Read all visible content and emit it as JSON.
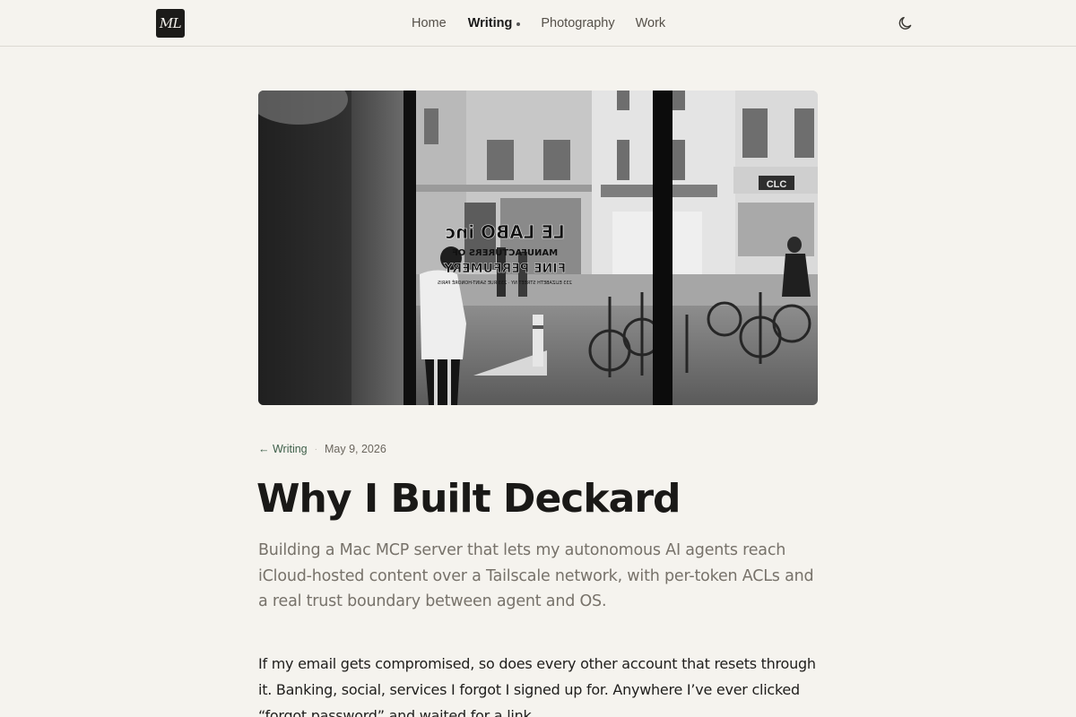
{
  "header": {
    "logo_text": "ML",
    "nav": [
      {
        "label": "Home",
        "active": false
      },
      {
        "label": "Writing",
        "active": true
      },
      {
        "label": "Photography",
        "active": false
      },
      {
        "label": "Work",
        "active": false
      }
    ],
    "theme_toggle_icon": "moon-icon"
  },
  "hero": {
    "storefront_text": [
      "LE LABO inc",
      "MANUFACTURERS OF",
      "FINE PERFUMERY"
    ],
    "storefront_small": "233 ELIZABETH STREET NY · 233 RUE SAINT-HONORÉ PARIS",
    "shop_sign": "CLC"
  },
  "article": {
    "back_label": "← Writing",
    "date": "May 9, 2026",
    "title": "Why I Built Deckard",
    "subtitle": "Building a Mac MCP server that lets my autonomous AI agents reach iCloud-hosted content over a Tailscale network, with per-token ACLs and a real trust boundary between agent and OS.",
    "body": "If my email gets compromised, so does every other account that resets through it. Banking, social, services I forgot I signed up for. Anywhere I’ve ever clicked “forgot password” and waited for a link."
  },
  "colors": {
    "background": "#f5f3ee",
    "accent": "#3e5f4a",
    "text": "#1a1917",
    "muted": "#77726a"
  }
}
